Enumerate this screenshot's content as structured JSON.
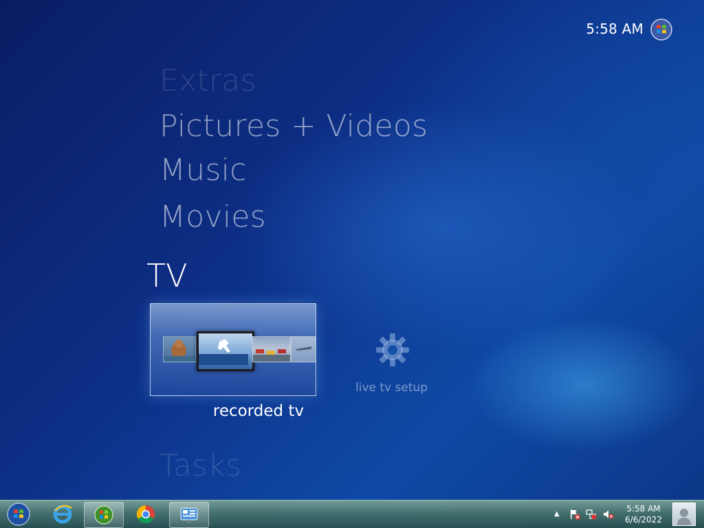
{
  "header": {
    "clock": "5:58 AM"
  },
  "menu": {
    "items": [
      {
        "label": "Extras"
      },
      {
        "label": "Pictures + Videos"
      },
      {
        "label": "Music"
      },
      {
        "label": "Movies"
      },
      {
        "label": "TV"
      },
      {
        "label": "Tasks"
      }
    ]
  },
  "tv": {
    "recorded_tv_label": "recorded tv",
    "live_tv_setup_label": "live tv setup"
  },
  "taskbar": {
    "time": "5:58 AM",
    "date": "6/6/2022",
    "apps": [
      "start-orb-icon",
      "internet-explorer-icon",
      "media-center-icon",
      "chrome-icon",
      "control-panel-icon"
    ]
  },
  "colors": {
    "background_dark": "#0a1d63",
    "background_mid": "#0f4aa6",
    "taskbar": "#46736e",
    "menu_text_dim": "#8a9fd0",
    "menu_text_active": "#ffffff"
  }
}
